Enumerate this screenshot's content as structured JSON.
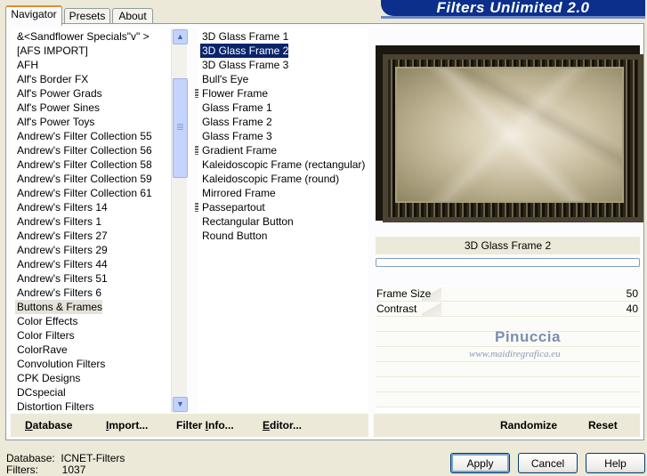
{
  "banner": {
    "title": "Filters Unlimited 2.0"
  },
  "tabs": [
    "Navigator",
    "Presets",
    "About"
  ],
  "categories": [
    "&<Sandflower Specials\"v\" >",
    "[AFS IMPORT]",
    "AFH",
    "Alf's Border FX",
    "Alf's Power Grads",
    "Alf's Power Sines",
    "Alf's Power Toys",
    "Andrew's Filter Collection 55",
    "Andrew's Filter Collection 56",
    "Andrew's Filter Collection 58",
    "Andrew's Filter Collection 59",
    "Andrew's Filter Collection 61",
    "Andrew's Filters 14",
    "Andrew's Filters 1",
    "Andrew's Filters 27",
    "Andrew's Filters 29",
    "Andrew's Filters 44",
    "Andrew's Filters 51",
    "Andrew's Filters 6",
    "Buttons & Frames",
    "Color Effects",
    "Color Filters",
    "ColorRave",
    "Convolution Filters",
    "CPK Designs",
    "DCspecial",
    "Distortion Filters"
  ],
  "selected_category": "Buttons & Frames",
  "filters": [
    {
      "label": "3D Glass Frame 1",
      "category": false
    },
    {
      "label": "3D Glass Frame 2",
      "category": false
    },
    {
      "label": "3D Glass Frame 3",
      "category": false
    },
    {
      "label": "Bull's Eye",
      "category": false
    },
    {
      "label": "Flower Frame",
      "category": true
    },
    {
      "label": "Glass Frame 1",
      "category": false
    },
    {
      "label": "Glass Frame 2",
      "category": false
    },
    {
      "label": "Glass Frame 3",
      "category": false
    },
    {
      "label": "Gradient Frame",
      "category": true
    },
    {
      "label": "Kaleidoscopic Frame (rectangular)",
      "category": false
    },
    {
      "label": "Kaleidoscopic Frame (round)",
      "category": false
    },
    {
      "label": "Mirrored Frame",
      "category": false
    },
    {
      "label": "Passepartout",
      "category": true
    },
    {
      "label": "Rectangular Button",
      "category": false
    },
    {
      "label": "Round Button",
      "category": false
    }
  ],
  "selected_filter": "3D Glass Frame 2",
  "preview": {
    "filter_name": "3D Glass Frame 2"
  },
  "controls": [
    {
      "name": "Frame Size",
      "value": "50"
    },
    {
      "name": "Contrast",
      "value": "40"
    }
  ],
  "watermark": {
    "line1": "Pinuccia",
    "line2": "www.maidiregrafica.eu"
  },
  "left_buttons": {
    "database": {
      "u": "D",
      "rest": "atabase"
    },
    "import": {
      "u": "I",
      "rest": "mport..."
    },
    "filter_info": {
      "pre": "Filter ",
      "u": "I",
      "rest": "nfo..."
    },
    "editor": {
      "u": "E",
      "rest": "ditor..."
    }
  },
  "right_buttons": {
    "randomize": "Randomize",
    "reset": "Reset"
  },
  "status": {
    "database_label": "Database:",
    "database_value": "ICNET-Filters",
    "filters_label": "Filters:",
    "filters_value": "1037"
  },
  "dialog_buttons": {
    "apply": "Apply",
    "cancel": "Cancel",
    "help": "Help"
  },
  "colors": {
    "banner": "#0c2f8c",
    "selection": "#0a246a",
    "panel": "#ece9d8"
  }
}
